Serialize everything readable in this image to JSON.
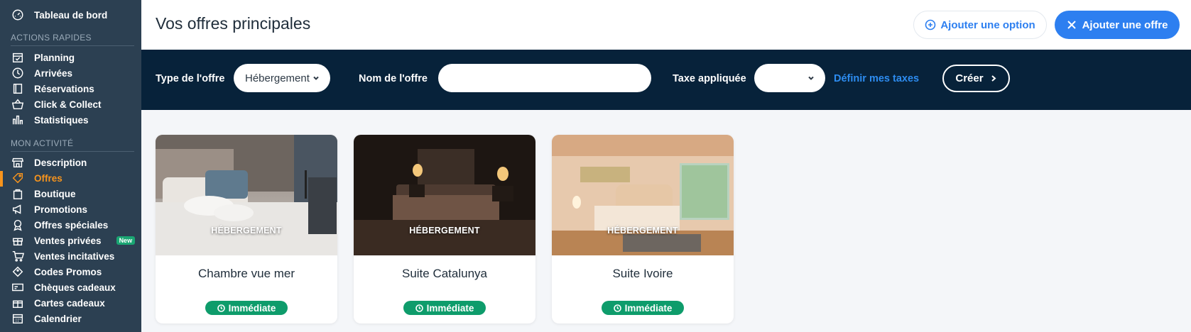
{
  "sidebar": {
    "dashboard": "Tableau de bord",
    "section_quick": "ACTIONS RAPIDES",
    "quick_items": [
      {
        "label": "Planning",
        "icon": "calendar-check-icon"
      },
      {
        "label": "Arrivées",
        "icon": "clock-icon"
      },
      {
        "label": "Réservations",
        "icon": "book-icon"
      },
      {
        "label": "Click & Collect",
        "icon": "basket-icon"
      },
      {
        "label": "Statistiques",
        "icon": "bar-chart-icon"
      }
    ],
    "section_activity": "MON ACTIVITÉ",
    "activity_items": [
      {
        "label": "Description",
        "icon": "store-icon"
      },
      {
        "label": "Offres",
        "icon": "tag-icon"
      },
      {
        "label": "Boutique",
        "icon": "shopping-bag-icon"
      },
      {
        "label": "Promotions",
        "icon": "megaphone-icon"
      },
      {
        "label": "Offres spéciales",
        "icon": "award-icon"
      },
      {
        "label": "Ventes privées",
        "icon": "gift-icon"
      },
      {
        "label": "Ventes incitatives",
        "icon": "cart-icon"
      },
      {
        "label": "Codes Promos",
        "icon": "coupon-icon"
      },
      {
        "label": "Chèques cadeaux",
        "icon": "voucher-icon"
      },
      {
        "label": "Cartes cadeaux",
        "icon": "gift-card-icon"
      },
      {
        "label": "Calendrier",
        "icon": "calendar-icon"
      }
    ],
    "new_badge": "New",
    "active_item": "Offres"
  },
  "header": {
    "title": "Vos offres principales",
    "add_option": "Ajouter une option",
    "add_offer": "Ajouter une offre"
  },
  "filters": {
    "type_label": "Type de l'offre",
    "type_value": "Hébergement",
    "name_label": "Nom de l'offre",
    "name_value": "",
    "tax_label": "Taxe appliquée",
    "tax_value": "",
    "define_taxes": "Définir mes taxes",
    "create": "Créer"
  },
  "offers": [
    {
      "category": "HÉBERGEMENT",
      "title": "Chambre vue mer",
      "badge": "Immédiate"
    },
    {
      "category": "HÉBERGEMENT",
      "title": "Suite Catalunya",
      "badge": "Immédiate"
    },
    {
      "category": "HÉBERGEMENT",
      "title": "Suite Ivoire",
      "badge": "Immédiate"
    }
  ],
  "colors": {
    "sidebar_bg": "#2c4052",
    "accent_orange": "#f7941d",
    "primary_blue": "#2d7ff0",
    "filter_bg": "#07223a",
    "badge_green": "#0e9c6b"
  }
}
